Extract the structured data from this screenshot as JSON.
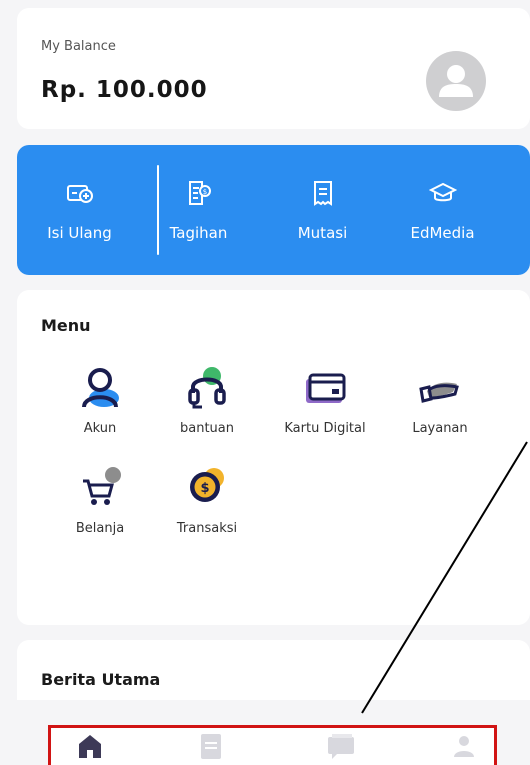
{
  "balance": {
    "label": "My Balance",
    "amount": "Rp. 100.000"
  },
  "actions": [
    {
      "label": "Isi Ulang",
      "icon": "wallet-plus-icon"
    },
    {
      "label": "Tagihan",
      "icon": "bill-icon"
    },
    {
      "label": "Mutasi",
      "icon": "receipt-icon"
    },
    {
      "label": "EdMedia",
      "icon": "graduation-cap-icon"
    }
  ],
  "menu": {
    "title": "Menu",
    "items": [
      {
        "label": "Akun",
        "icon": "user-icon"
      },
      {
        "label": "bantuan",
        "icon": "headset-icon"
      },
      {
        "label": "Kartu Digital",
        "icon": "card-icon"
      },
      {
        "label": "Layanan",
        "icon": "hand-service-icon"
      },
      {
        "label": "Belanja",
        "icon": "cart-icon"
      },
      {
        "label": "Transaksi",
        "icon": "coin-icon"
      }
    ]
  },
  "news": {
    "title": "Berita Utama"
  },
  "bottom_nav": {
    "items": [
      {
        "icon": "home-icon",
        "active": true
      },
      {
        "icon": "document-icon",
        "active": false
      },
      {
        "icon": "chat-icon",
        "active": false
      },
      {
        "icon": "profile-icon",
        "active": false
      }
    ]
  },
  "colors": {
    "accent": "#2b8df0",
    "annotation_box": "#d11414",
    "nav_active": "#3d3a57",
    "nav_inactive": "#d8d8de"
  }
}
